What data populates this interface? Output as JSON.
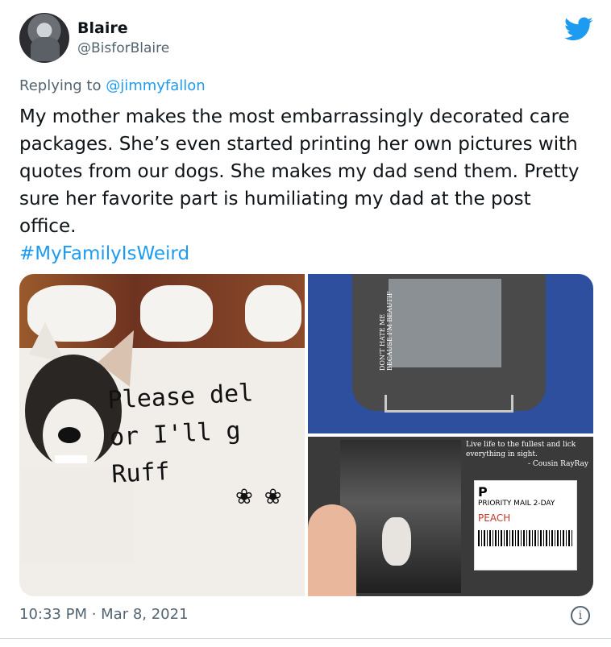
{
  "author": {
    "name": "Blaire",
    "handle": "@BisforBlaire"
  },
  "reply": {
    "prefix": "Replying to ",
    "to": "@jimmyfallon"
  },
  "tweet": {
    "text": "My mother makes the most embarrassingly decorated care packages. She’s even started printing her own pictures with quotes from our dogs. She makes my dad send them. Pretty sure her favorite part is humiliating my dad at the post office.",
    "hashtag": "#MyFamilyIsWeird"
  },
  "media": {
    "photo1": {
      "note_line1": "Please del",
      "note_line2": "or I'll g",
      "note_line3": "Ruff"
    },
    "photo2": {
      "side_text": "DON'T HATE ME BECAUSE I'M BEAUTIF"
    },
    "photo3": {
      "quote": "Live life to the fullest and lick everything in sight.",
      "attribution": "- Cousin RayRay",
      "label_letter": "P",
      "label_service": "PRIORITY MAIL 2-DAY",
      "label_name": "PEACH"
    }
  },
  "footer": {
    "timestamp": "10:33 PM · Mar 8, 2021",
    "info_symbol": "i"
  },
  "colors": {
    "link": "#1d9bf0",
    "secondary_text": "#536471",
    "primary_text": "#0f1419"
  },
  "icons": [
    "twitter-bird-icon",
    "info-icon"
  ]
}
